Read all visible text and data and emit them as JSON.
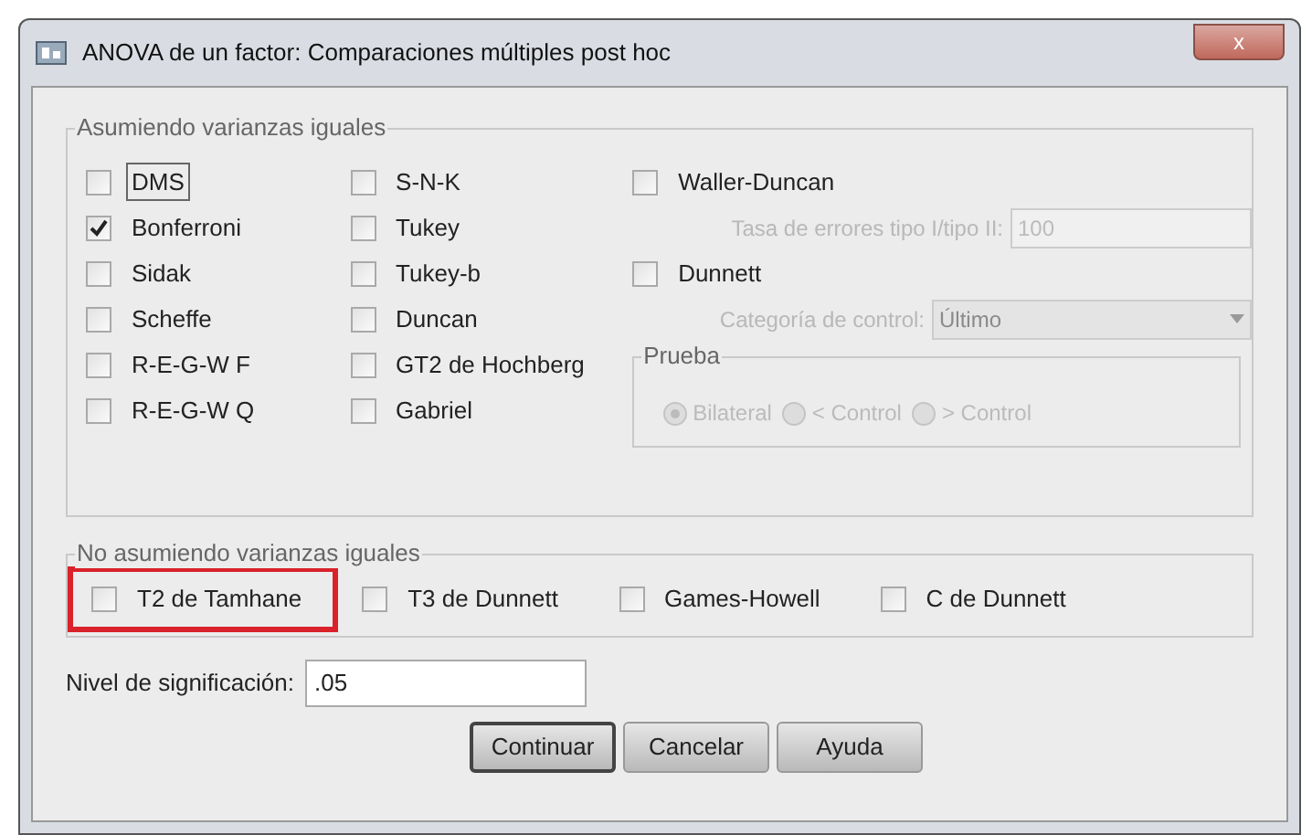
{
  "window": {
    "title": "ANOVA de un factor: Comparaciones múltiples post hoc",
    "close": "x"
  },
  "equal_variances": {
    "title": "Asumiendo varianzas iguales",
    "column_1": [
      {
        "label": "DMS",
        "checked": false,
        "focused": true
      },
      {
        "label": "Bonferroni",
        "checked": true,
        "focused": false
      },
      {
        "label": "Sidak",
        "checked": false,
        "focused": false
      },
      {
        "label": "Scheffe",
        "checked": false,
        "focused": false
      },
      {
        "label": "R-E-G-W F",
        "checked": false,
        "focused": false
      },
      {
        "label": "R-E-G-W Q",
        "checked": false,
        "focused": false
      }
    ],
    "column_2": [
      {
        "label": "S-N-K",
        "checked": false
      },
      {
        "label": "Tukey",
        "checked": false
      },
      {
        "label": "Tukey-b",
        "checked": false
      },
      {
        "label": "Duncan",
        "checked": false
      },
      {
        "label": "GT2 de Hochberg",
        "checked": false
      },
      {
        "label": "Gabriel",
        "checked": false
      }
    ],
    "waller_duncan": {
      "label": "Waller-Duncan",
      "checked": false,
      "ratio_label": "Tasa de errores tipo I/tipo II:",
      "ratio_value": "100",
      "disabled": true
    },
    "dunnett": {
      "label": "Dunnett",
      "checked": false,
      "category_label": "Categoría de control:",
      "category_value": "Último",
      "disabled": true,
      "test": {
        "title": "Prueba",
        "options": [
          {
            "label": "Bilateral",
            "selected": true
          },
          {
            "label": "< Control",
            "selected": false
          },
          {
            "label": "> Control",
            "selected": false
          }
        ]
      }
    }
  },
  "unequal_variances": {
    "title": "No asumiendo varianzas iguales",
    "items": [
      {
        "label": "T2 de Tamhane",
        "checked": false,
        "highlighted": true
      },
      {
        "label": "T3 de Dunnett",
        "checked": false,
        "highlighted": false
      },
      {
        "label": "Games-Howell",
        "checked": false,
        "highlighted": false
      },
      {
        "label": "C de Dunnett",
        "checked": false,
        "highlighted": false
      }
    ]
  },
  "significance": {
    "label": "Nivel de significación:",
    "value": ".05"
  },
  "buttons": [
    {
      "label": "Continuar",
      "focused": true
    },
    {
      "label": "Cancelar",
      "focused": false
    },
    {
      "label": "Ayuda",
      "focused": false
    }
  ]
}
